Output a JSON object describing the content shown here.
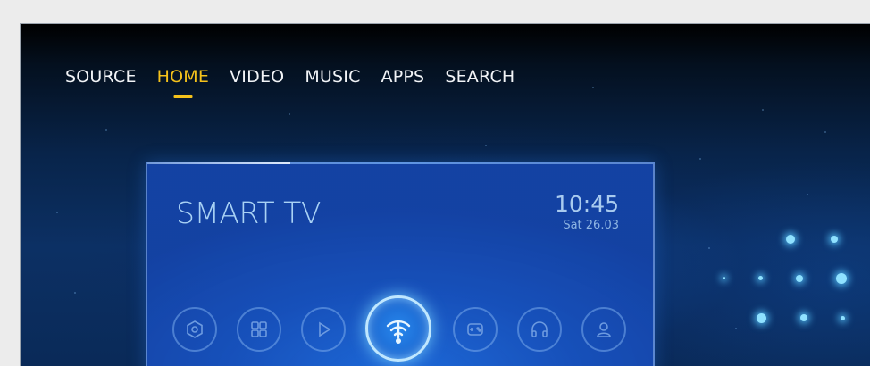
{
  "nav": {
    "items": [
      {
        "label": "SOURCE",
        "active": false
      },
      {
        "label": "HOME",
        "active": true
      },
      {
        "label": "VIDEO",
        "active": false
      },
      {
        "label": "MUSIC",
        "active": false
      },
      {
        "label": "APPS",
        "active": false
      },
      {
        "label": "SEARCH",
        "active": false
      }
    ]
  },
  "tv_panel": {
    "title": "SMART TV",
    "time": "10:45",
    "date": "Sat 26.03"
  },
  "apps": [
    {
      "icon": "settings-hexagon-icon",
      "selected": false
    },
    {
      "icon": "grid-apps-icon",
      "selected": false
    },
    {
      "icon": "play-icon",
      "selected": false
    },
    {
      "icon": "wifi-icon",
      "selected": true
    },
    {
      "icon": "gamepad-icon",
      "selected": false
    },
    {
      "icon": "headphones-icon",
      "selected": false
    },
    {
      "icon": "user-profile-icon",
      "selected": false
    }
  ],
  "colors": {
    "accent": "#f5c21b",
    "nav_text": "#f2f4f7",
    "panel_blue": "#1b58b5",
    "glow": "#8fe1ff"
  }
}
